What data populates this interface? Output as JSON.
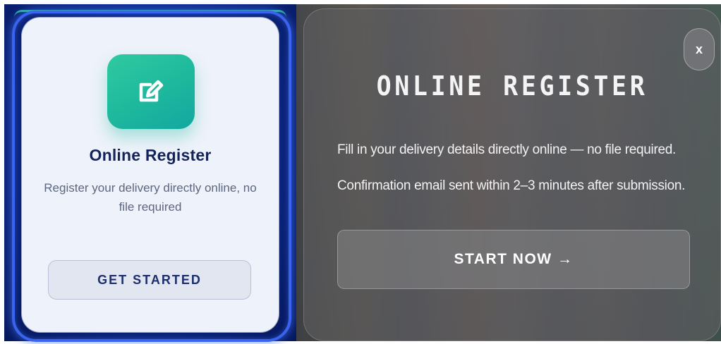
{
  "colors": {
    "card_bg": "#eef2fa",
    "icon_tile": "#1db89d",
    "title_text": "#14245a",
    "desc_text": "#5d6680",
    "button_text": "#1d2e6b",
    "modal_text": "#f4f4f4",
    "panel_glow": "#3a64ef"
  },
  "card": {
    "icon": "edit-icon",
    "title": "Online Register",
    "description": "Register your delivery directly online, no file required",
    "button_label": "GET STARTED"
  },
  "modal": {
    "close_icon": "close-icon",
    "close_label": "x",
    "title": "ONLINE REGISTER",
    "line1": "Fill in your delivery details directly online — no file required.",
    "line2": "Confirmation email sent within 2–3 minutes after submission.",
    "cta_label": "START NOW →"
  }
}
